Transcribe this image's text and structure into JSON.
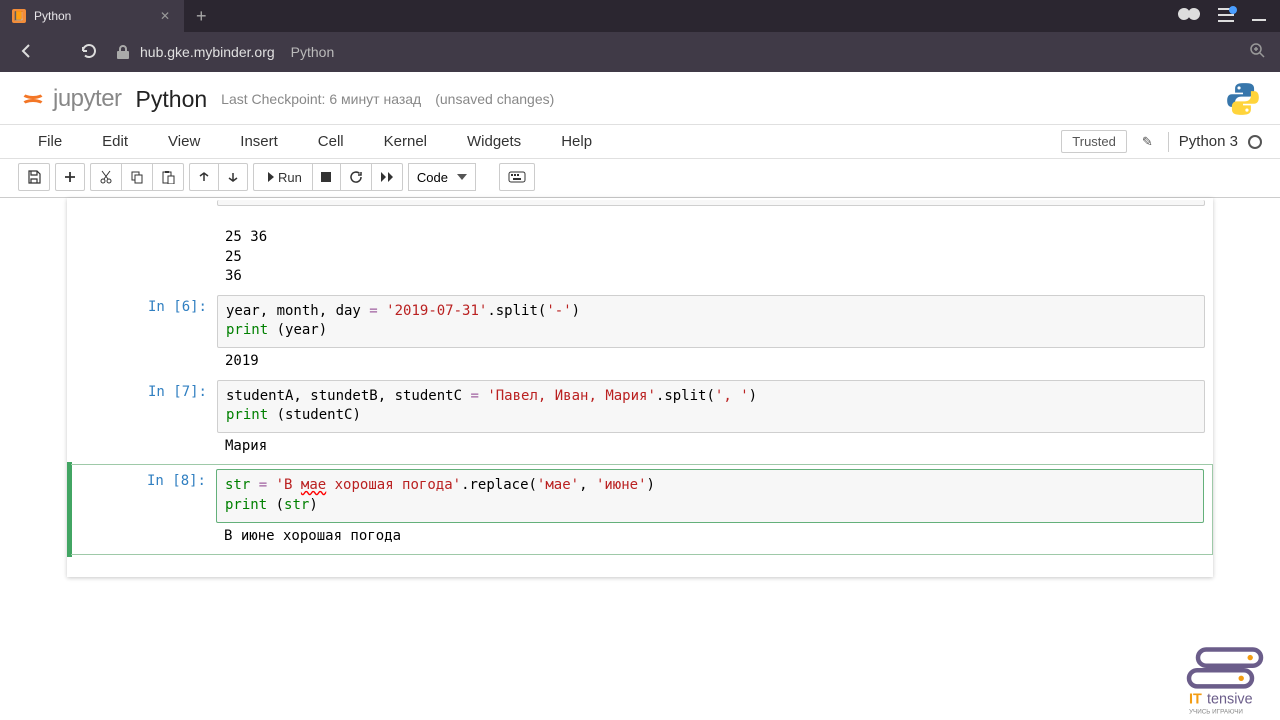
{
  "browser": {
    "tab_title": "Python",
    "url_host": "hub.gke.mybinder.org",
    "url_path": "Python"
  },
  "header": {
    "logo_text": "jupyter",
    "notebook_name": "Python",
    "checkpoint": "Last Checkpoint: 6 минут назад",
    "unsaved": "(unsaved changes)"
  },
  "menubar": {
    "items": [
      "File",
      "Edit",
      "View",
      "Insert",
      "Cell",
      "Kernel",
      "Widgets",
      "Help"
    ],
    "trusted": "Trusted",
    "kernel": "Python 3"
  },
  "toolbar": {
    "run_label": "Run",
    "cell_type": "Code"
  },
  "cells": {
    "out5": "25 36\n25\n36",
    "in6_prompt": "In [6]:",
    "in6_line1_a": "year, month, day ",
    "in6_line1_op": "=",
    "in6_line1_b": " ",
    "in6_line1_str": "'2019-07-31'",
    "in6_line1_c": ".split(",
    "in6_line1_str2": "'-'",
    "in6_line1_d": ")",
    "in6_line2_a": "print",
    "in6_line2_b": " (year)",
    "out6": "2019",
    "in7_prompt": "In [7]:",
    "in7_line1_a": "studentA, stundetB, studentC ",
    "in7_line1_op": "=",
    "in7_line1_b": " ",
    "in7_line1_str": "'Павел, Иван, Мария'",
    "in7_line1_c": ".split(",
    "in7_line1_str2": "', '",
    "in7_line1_d": ")",
    "in7_line2_a": "print",
    "in7_line2_b": " (studentC)",
    "out7": "Мария",
    "in8_prompt": "In [8]:",
    "in8_line1_a": "str",
    "in8_line1_b": " ",
    "in8_line1_op": "=",
    "in8_line1_c": " ",
    "in8_line1_str_a": "'В ",
    "in8_line1_str_err": "мае",
    "in8_line1_str_b": " хорошая погода'",
    "in8_line1_d": ".replace(",
    "in8_line1_str2": "'мае'",
    "in8_line1_e": ", ",
    "in8_line1_str3": "'июне'",
    "in8_line1_f": ")",
    "in8_line2_a": "print",
    "in8_line2_b": " (",
    "in8_line2_c": "str",
    "in8_line2_d": ")",
    "out8": "В июне хорошая погода"
  },
  "watermark": {
    "brand": "ITtensive",
    "tagline": "УЧИСЬ ИГРАЮЧИ"
  }
}
